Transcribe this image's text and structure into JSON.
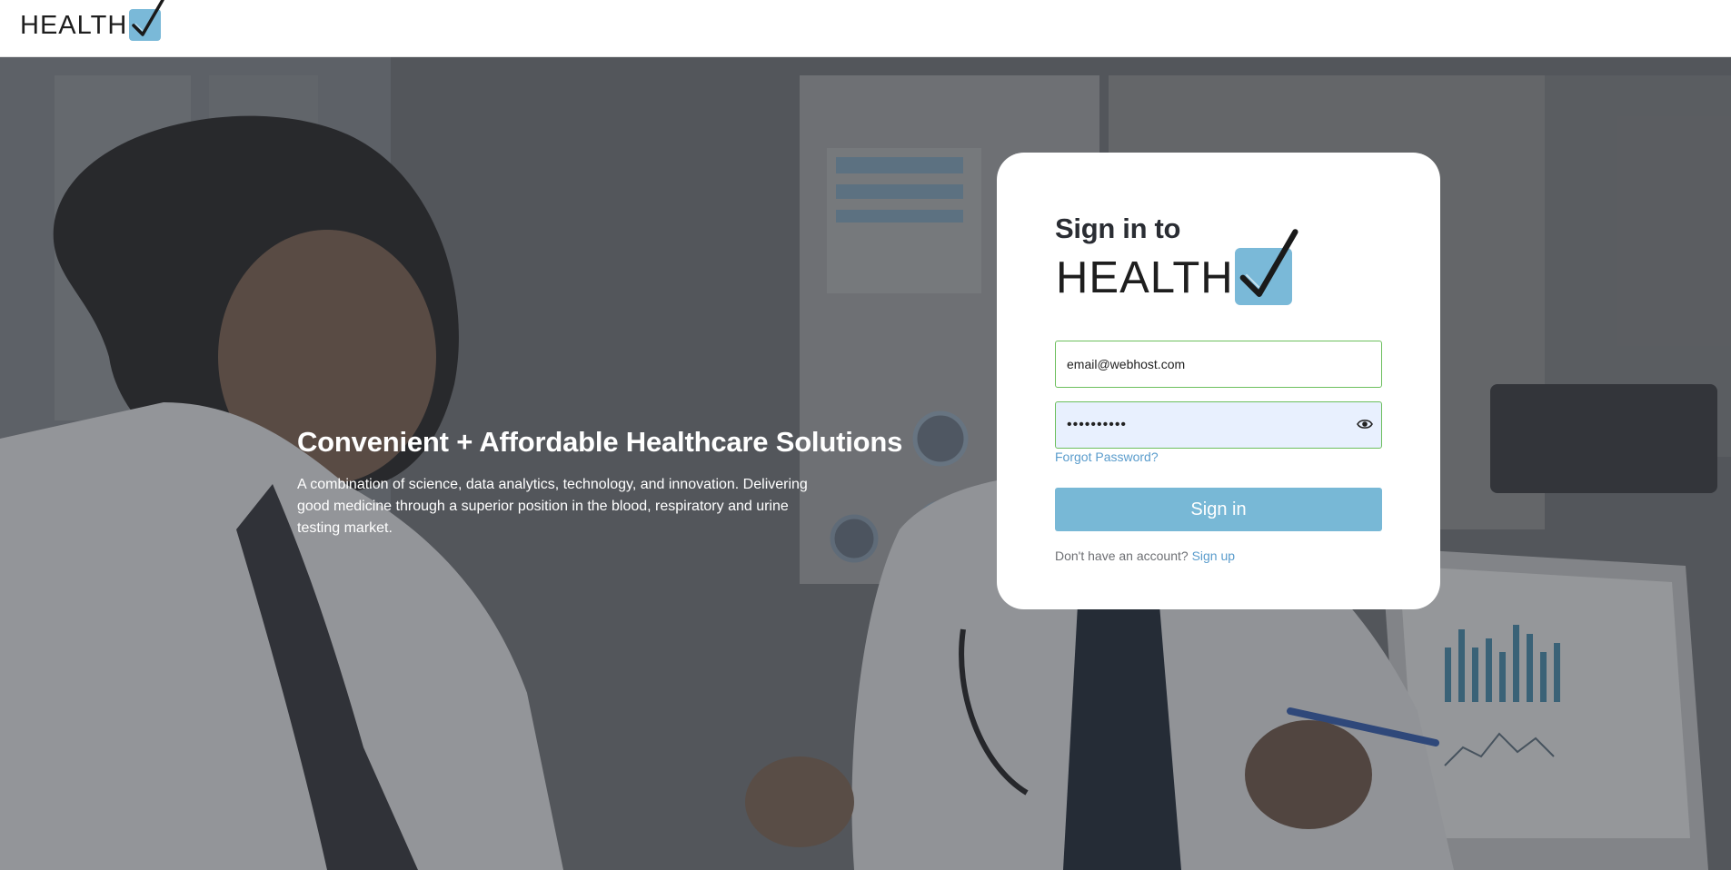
{
  "brand": {
    "logo_text": "HEALTH",
    "logo_color": "#7ab9d8",
    "check_icon": "checkmark-icon"
  },
  "hero": {
    "headline": "Convenient + Affordable Healthcare Solutions",
    "description": "A combination of science, data analytics, technology, and innovation. Delivering good medicine through a superior position in the blood, respiratory and urine testing market."
  },
  "signin": {
    "title": "Sign in to",
    "email_value": "email@webhost.com",
    "password_value": "••••••••••",
    "show_password_icon": "eye-icon",
    "forgot_password": "Forgot Password?",
    "button_label": "Sign in",
    "no_account_text": "Don't have an account?",
    "signup_link": "Sign up"
  },
  "colors": {
    "accent": "#78b8d6",
    "link": "#5a9ccc",
    "field_border": "#6cbf5d"
  }
}
